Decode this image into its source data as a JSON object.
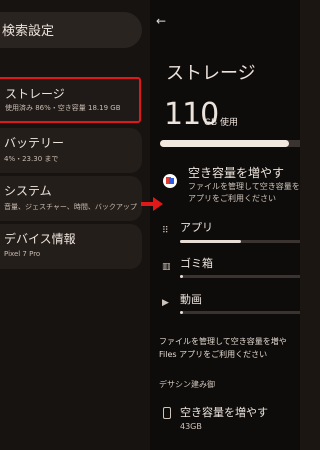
{
  "settings_list": {
    "search_title": "検索設定",
    "items": [
      {
        "title": "ストレージ",
        "subtitle": "使用済み 86%・空き容量 18.19 GB",
        "highlighted": true
      },
      {
        "title": "バッテリー",
        "subtitle": "4%・23.30 まで"
      },
      {
        "title": "システム",
        "subtitle": "音量、ジェスチャー、時間、バックアップ"
      },
      {
        "title": "デバイス情報",
        "subtitle": "Pixel 7 Pro"
      }
    ]
  },
  "storage_page": {
    "back_icon": "arrow-back-icon",
    "title": "ストレージ",
    "used_value": "110",
    "used_suffix": "GB 使用",
    "used_fraction": 0.86,
    "free_up": {
      "icon": "files-app-icon",
      "title": "空き容量を増やす",
      "desc_line1": "ファイルを管理して空き容量を",
      "desc_line2": "アプリをご利用ください"
    },
    "categories": [
      {
        "icon": "apps-grid-icon",
        "label": "アプリ",
        "fraction": 0.47
      },
      {
        "icon": "trash-icon",
        "label": "ゴミ箱",
        "fraction": 0.02
      },
      {
        "icon": "video-icon",
        "label": "動画",
        "fraction": 0.02
      }
    ],
    "files_note_line1": "ファイルを管理して空き容量を増や",
    "files_note_line2": "Files アプリをご利用ください",
    "section_label": "デサシン建み御",
    "suggestion": {
      "icon": "phone-storage-icon",
      "title": "空き容量を増やす",
      "size": "43GB"
    }
  },
  "colors": {
    "highlight_border": "#e01818",
    "arrow": "#e01818"
  }
}
